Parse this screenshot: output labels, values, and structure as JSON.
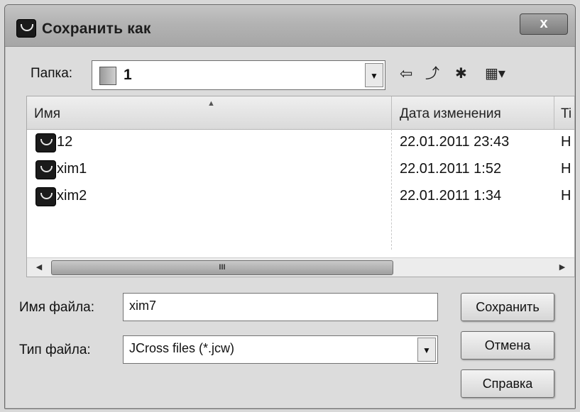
{
  "window": {
    "title": "Сохранить как",
    "close_label": "x"
  },
  "folder_bar": {
    "label": "Папка:",
    "value": "1"
  },
  "toolbar": {
    "back_glyph": "⇦",
    "up_glyph": "⤴",
    "new_folder_glyph": "✱",
    "view_glyph": "▦▾"
  },
  "file_list": {
    "columns": [
      "Имя",
      "Дата изменения",
      "Ti"
    ],
    "rows": [
      {
        "name": "12",
        "date": "22.01.2011 23:43",
        "type": "H"
      },
      {
        "name": "xim1",
        "date": "22.01.2011 1:52",
        "type": "H"
      },
      {
        "name": "xim2",
        "date": "22.01.2011 1:34",
        "type": "H"
      }
    ],
    "scroll_thumb_text": "III"
  },
  "file_name": {
    "label": "Имя файла:",
    "value": "xim7"
  },
  "file_type": {
    "label": "Тип файла:",
    "value": "JCross files (*.jcw)"
  },
  "buttons": {
    "save": "Сохранить",
    "cancel": "Отмена",
    "help": "Справка"
  }
}
